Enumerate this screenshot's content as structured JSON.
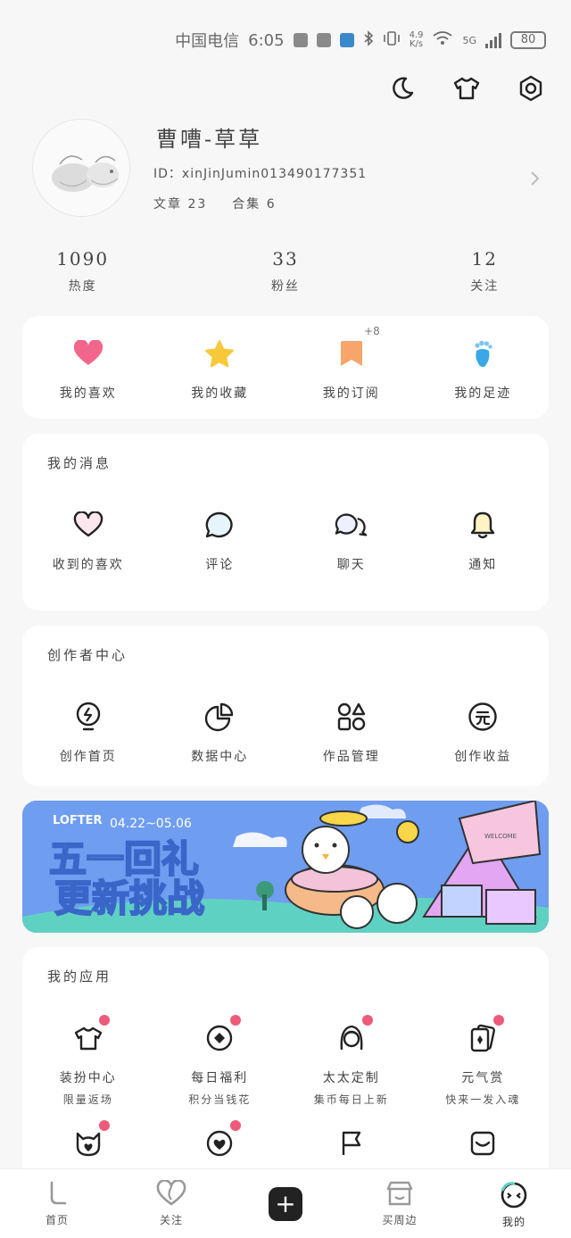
{
  "status_bar": {
    "carrier": "中国电信",
    "time": "6:05",
    "net_speed_top": "4.9",
    "net_speed_bottom": "K/s",
    "signal_label": "5G",
    "battery": "80"
  },
  "profile": {
    "username": "曹嘈-草草",
    "user_id": "ID：xinJinJumin013490177351",
    "articles": "文章 23",
    "collections": "合集 6"
  },
  "stats": [
    {
      "value": "1090",
      "label": "热度"
    },
    {
      "value": "33",
      "label": "粉丝"
    },
    {
      "value": "12",
      "label": "关注"
    }
  ],
  "quick_actions": [
    {
      "label": "我的喜欢",
      "icon": "heart-icon"
    },
    {
      "label": "我的收藏",
      "icon": "star-icon"
    },
    {
      "label": "我的订阅",
      "icon": "bookmark-icon",
      "badge": "+8"
    },
    {
      "label": "我的足迹",
      "icon": "footprint-icon"
    }
  ],
  "messages": {
    "title": "我的消息",
    "items": [
      {
        "label": "收到的喜欢",
        "icon": "heart-outline-icon"
      },
      {
        "label": "评论",
        "icon": "comment-icon"
      },
      {
        "label": "聊天",
        "icon": "chat-icon"
      },
      {
        "label": "通知",
        "icon": "bell-icon"
      }
    ]
  },
  "creator": {
    "title": "创作者中心",
    "items": [
      {
        "label": "创作首页",
        "icon": "bulb-icon"
      },
      {
        "label": "数据中心",
        "icon": "pie-chart-icon"
      },
      {
        "label": "作品管理",
        "icon": "shapes-icon"
      },
      {
        "label": "创作收益",
        "icon": "yuan-icon"
      }
    ]
  },
  "banner": {
    "brand": "LOFTER",
    "dates": "04.22~05.06",
    "line1": "五一回礼",
    "line2": "更新挑战",
    "tag": "WELCOME"
  },
  "apps": {
    "title": "我的应用",
    "items": [
      {
        "label": "装扮中心",
        "sub": "限量返场",
        "icon": "tshirt-icon"
      },
      {
        "label": "每日福利",
        "sub": "积分当钱花",
        "icon": "coin-icon"
      },
      {
        "label": "太太定制",
        "sub": "集币每日上新",
        "icon": "girl-icon"
      },
      {
        "label": "元气赏",
        "sub": "快来一发入魂",
        "icon": "cards-icon"
      },
      {
        "label": "",
        "sub": "",
        "icon": "cat-heart-icon"
      },
      {
        "label": "",
        "sub": "",
        "icon": "heart-badge-icon"
      },
      {
        "label": "",
        "sub": "",
        "icon": "flag-icon"
      },
      {
        "label": "",
        "sub": "",
        "icon": "inbox-icon"
      }
    ]
  },
  "nav": [
    {
      "label": "首页",
      "icon": "home-icon"
    },
    {
      "label": "关注",
      "icon": "follow-heart-icon"
    },
    {
      "label": "",
      "icon": "plus-icon"
    },
    {
      "label": "买周边",
      "icon": "shop-icon"
    },
    {
      "label": "我的",
      "icon": "me-face-icon"
    }
  ],
  "colors": {
    "accent_pink": "#ef5a7a",
    "heart_pink": "#f2668b",
    "star_yellow": "#f7c93a",
    "bookmark_orange": "#f7a56a",
    "footprint_blue": "#3aa8e6",
    "banner_blue": "#6f9df0"
  }
}
